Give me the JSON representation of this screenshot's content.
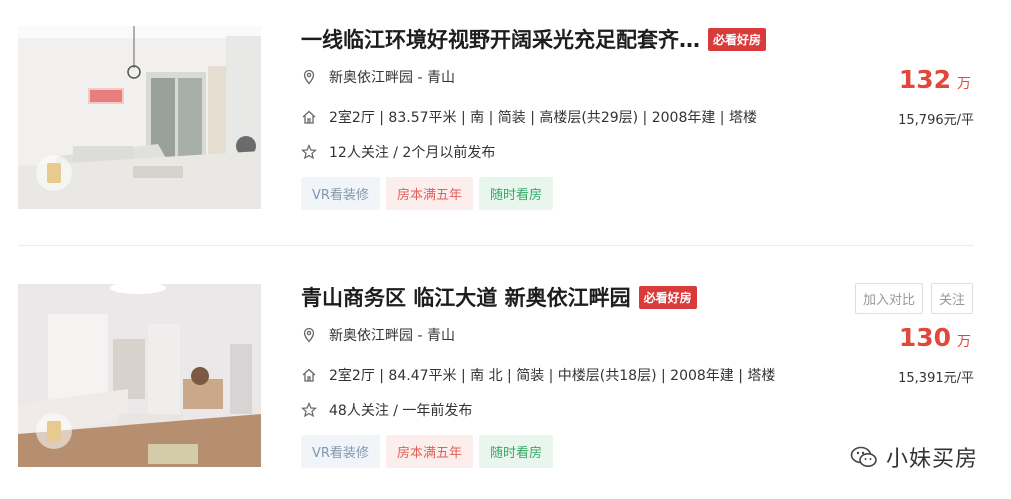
{
  "listings": [
    {
      "title": "一线临江环境好视野开阔采光充足配套齐…",
      "badge": "必看好房",
      "location": "新奥依江畔园 - 青山",
      "attributes": "2室2厅 | 83.57平米 | 南 | 简装 | 高楼层(共29层) | 2008年建 | 塔楼",
      "follow": "12人关注 / 2个月以前发布",
      "tags": [
        "VR看装修",
        "房本满五年",
        "随时看房"
      ],
      "price": "132",
      "price_unit": "万",
      "unit_price": "15,796元/平"
    },
    {
      "title": "青山商务区 临江大道 新奥依江畔园",
      "badge": "必看好房",
      "location": "新奥依江畔园 - 青山",
      "attributes": "2室2厅 | 84.47平米 | 南 北 | 简装 | 中楼层(共18层) | 2008年建 | 塔楼",
      "follow": "48人关注 / 一年前发布",
      "tags": [
        "VR看装修",
        "房本满五年",
        "随时看房"
      ],
      "price": "130",
      "price_unit": "万",
      "unit_price": "15,391元/平",
      "actions": {
        "compare": "加入对比",
        "follow": "关注"
      }
    }
  ],
  "watermark": "小妹买房",
  "colors": {
    "price": "#e1483c",
    "badge": "#d93a3a",
    "tag_vr": "#8297ad",
    "tag_five": "#e0625a",
    "tag_see": "#36a866"
  },
  "icons": {
    "location": "location-pin-icon",
    "attributes": "house-icon",
    "follow": "star-icon"
  }
}
